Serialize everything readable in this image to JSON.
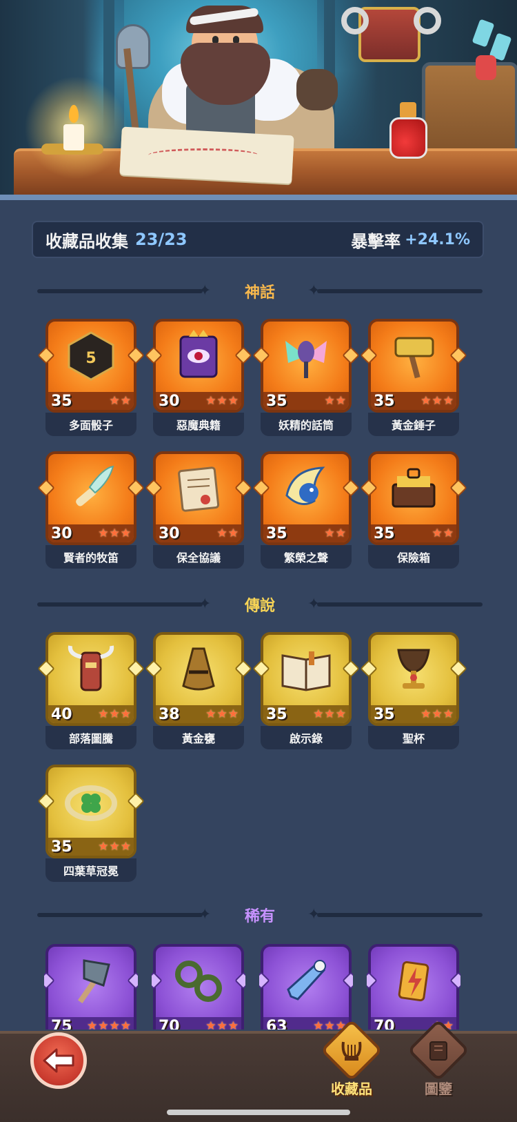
{
  "collection": {
    "label": "收藏品收集",
    "count": "23/23",
    "crit_label": "暴擊率",
    "crit_value": "+24.1%"
  },
  "sections": {
    "mythic": "神話",
    "legendary": "傳說",
    "rare": "稀有"
  },
  "colors": {
    "mythic": "#f47c19",
    "legendary": "#e4c03e",
    "rare": "#8d52d6",
    "section_mythic": "#f7b84d",
    "section_legendary": "#f7d456",
    "section_rare": "#c792ff"
  },
  "mythic_items": [
    {
      "name": "多面骰子",
      "level": "35",
      "stars": 2,
      "icon": "d20-dice-icon"
    },
    {
      "name": "惡魔典籍",
      "level": "30",
      "stars": 3,
      "icon": "demon-book-icon"
    },
    {
      "name": "妖精的話筒",
      "level": "35",
      "stars": 2,
      "icon": "fairy-microphone-icon"
    },
    {
      "name": "黃金錘子",
      "level": "35",
      "stars": 3,
      "icon": "golden-hammer-icon"
    },
    {
      "name": "賢者的牧笛",
      "level": "30",
      "stars": 3,
      "icon": "sage-flute-icon"
    },
    {
      "name": "保全協議",
      "level": "30",
      "stars": 2,
      "icon": "contract-scroll-icon"
    },
    {
      "name": "繁榮之聲",
      "level": "35",
      "stars": 2,
      "icon": "prosperity-horn-icon"
    },
    {
      "name": "保險箱",
      "level": "35",
      "stars": 2,
      "icon": "treasure-chest-icon"
    }
  ],
  "legendary_items": [
    {
      "name": "部落圖騰",
      "level": "40",
      "stars": 3,
      "icon": "tribal-totem-icon"
    },
    {
      "name": "黃金甕",
      "level": "38",
      "stars": 3,
      "icon": "golden-urn-icon"
    },
    {
      "name": "啟示錄",
      "level": "35",
      "stars": 3,
      "icon": "open-book-icon"
    },
    {
      "name": "聖杯",
      "level": "35",
      "stars": 3,
      "icon": "holy-grail-icon"
    },
    {
      "name": "四葉草冠冕",
      "level": "35",
      "stars": 3,
      "icon": "clover-tiara-icon"
    }
  ],
  "rare_items": [
    {
      "name": "",
      "level": "75",
      "stars": 4,
      "icon": "axe-icon"
    },
    {
      "name": "",
      "level": "70",
      "stars": 3,
      "icon": "thorn-shackles-icon"
    },
    {
      "name": "",
      "level": "63",
      "stars": 3,
      "icon": "ice-dagger-icon"
    },
    {
      "name": "",
      "level": "70",
      "stars": 2,
      "icon": "lightning-gem-icon"
    }
  ],
  "nav": {
    "collection_label": "收藏品",
    "codex_label": "圖鑒",
    "back_icon": "back-arrow-icon"
  }
}
